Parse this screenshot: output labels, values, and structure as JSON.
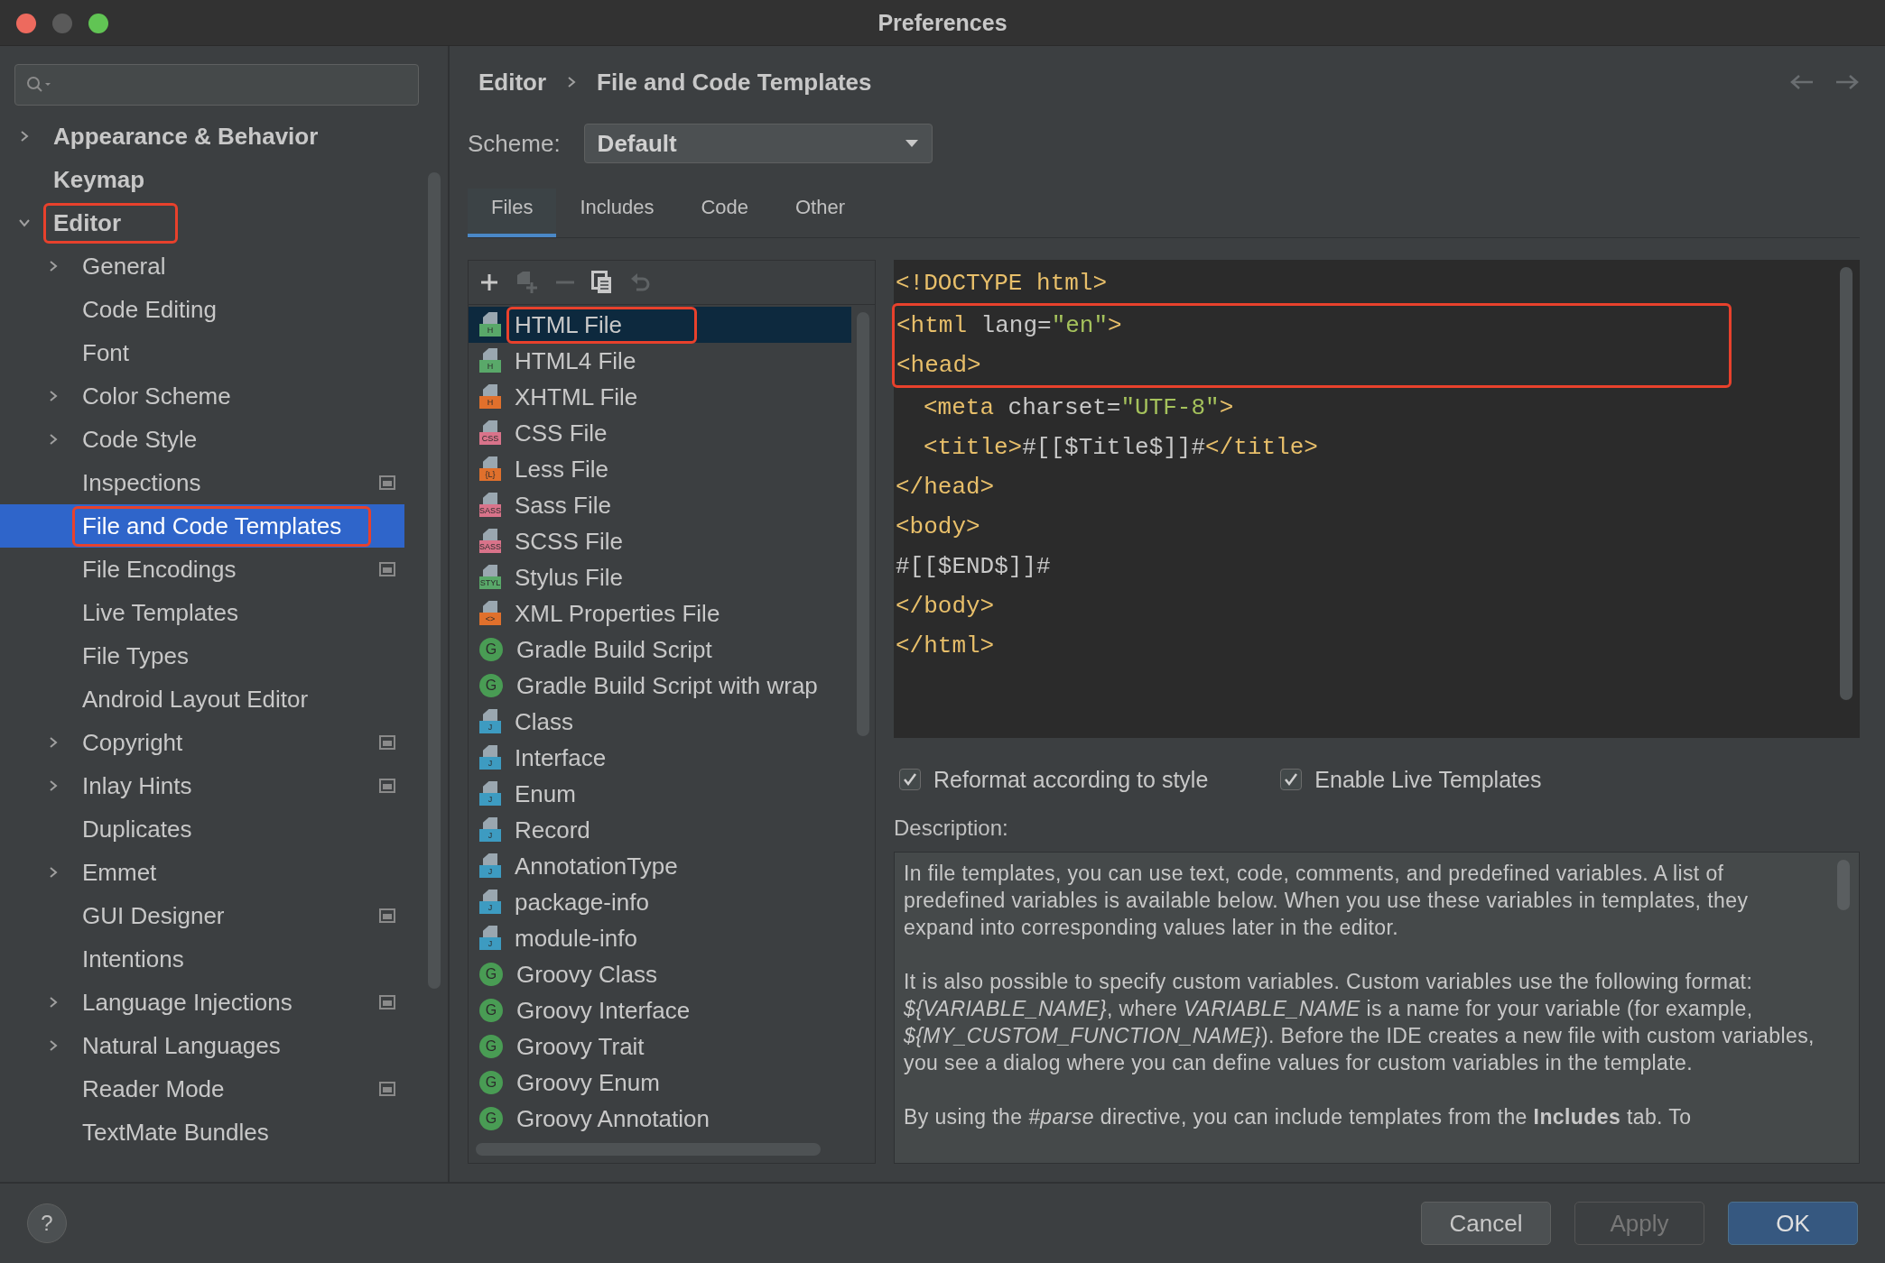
{
  "window": {
    "title": "Preferences"
  },
  "sidebar": {
    "items": [
      {
        "label": "Appearance & Behavior",
        "expanded": false,
        "selected": false,
        "highlighted": false
      },
      {
        "label": "Keymap",
        "selected": false,
        "highlighted": false
      },
      {
        "label": "Editor",
        "expanded": true,
        "selected": false,
        "highlighted": true,
        "children": [
          {
            "label": "General",
            "expanded": false,
            "selected": false,
            "highlighted": false
          },
          {
            "label": "Code Editing",
            "selected": false,
            "highlighted": false
          },
          {
            "label": "Font",
            "selected": false,
            "highlighted": false
          },
          {
            "label": "Color Scheme",
            "expanded": false,
            "selected": false,
            "highlighted": false
          },
          {
            "label": "Code Style",
            "expanded": false,
            "selected": false,
            "highlighted": false
          },
          {
            "label": "Inspections",
            "selected": false,
            "highlighted": false,
            "project_icon": true
          },
          {
            "label": "File and Code Templates",
            "selected": true,
            "highlighted": true
          },
          {
            "label": "File Encodings",
            "selected": false,
            "highlighted": false,
            "project_icon": true
          },
          {
            "label": "Live Templates",
            "selected": false,
            "highlighted": false
          },
          {
            "label": "File Types",
            "selected": false,
            "highlighted": false
          },
          {
            "label": "Android Layout Editor",
            "selected": false,
            "highlighted": false
          },
          {
            "label": "Copyright",
            "expanded": false,
            "selected": false,
            "highlighted": false,
            "project_icon": true
          },
          {
            "label": "Inlay Hints",
            "expanded": false,
            "selected": false,
            "highlighted": false,
            "project_icon": true
          },
          {
            "label": "Duplicates",
            "selected": false,
            "highlighted": false
          },
          {
            "label": "Emmet",
            "expanded": false,
            "selected": false,
            "highlighted": false
          },
          {
            "label": "GUI Designer",
            "selected": false,
            "highlighted": false,
            "project_icon": true
          },
          {
            "label": "Intentions",
            "selected": false,
            "highlighted": false
          },
          {
            "label": "Language Injections",
            "expanded": false,
            "selected": false,
            "highlighted": false,
            "project_icon": true
          },
          {
            "label": "Natural Languages",
            "expanded": false,
            "selected": false,
            "highlighted": false
          },
          {
            "label": "Reader Mode",
            "selected": false,
            "highlighted": false,
            "project_icon": true
          },
          {
            "label": "TextMate Bundles",
            "selected": false,
            "highlighted": false
          }
        ]
      }
    ]
  },
  "breadcrumb": [
    "Editor",
    "File and Code Templates"
  ],
  "scheme": {
    "label": "Scheme:",
    "value": "Default"
  },
  "tabs": [
    {
      "label": "Files",
      "selected": true
    },
    {
      "label": "Includes",
      "selected": false
    },
    {
      "label": "Code",
      "selected": false
    },
    {
      "label": "Other",
      "selected": false
    }
  ],
  "toolbar": [
    {
      "kind": "add",
      "disabled": false
    },
    {
      "kind": "add-copy",
      "disabled": true
    },
    {
      "kind": "remove",
      "disabled": true
    },
    {
      "kind": "copy",
      "disabled": false
    },
    {
      "kind": "reset",
      "disabled": true
    }
  ],
  "templates": [
    {
      "label": "HTML File",
      "selected": true,
      "highlighted": true,
      "icon": {
        "kind": "file",
        "text": "H",
        "color": "#59a869"
      }
    },
    {
      "label": "HTML4 File",
      "selected": false,
      "highlighted": false,
      "icon": {
        "kind": "file",
        "text": "H",
        "color": "#59a869"
      }
    },
    {
      "label": "XHTML File",
      "selected": false,
      "highlighted": false,
      "icon": {
        "kind": "file",
        "text": "H",
        "color": "#e0702c"
      }
    },
    {
      "label": "CSS File",
      "selected": false,
      "highlighted": false,
      "icon": {
        "kind": "file",
        "text": "CSS",
        "color": "#d9738a"
      }
    },
    {
      "label": "Less File",
      "selected": false,
      "highlighted": false,
      "icon": {
        "kind": "file",
        "text": "{L}",
        "color": "#e0702c"
      }
    },
    {
      "label": "Sass File",
      "selected": false,
      "highlighted": false,
      "icon": {
        "kind": "file",
        "text": "SASS",
        "color": "#d9738a"
      }
    },
    {
      "label": "SCSS File",
      "selected": false,
      "highlighted": false,
      "icon": {
        "kind": "file",
        "text": "SASS",
        "color": "#d9738a"
      }
    },
    {
      "label": "Stylus File",
      "selected": false,
      "highlighted": false,
      "icon": {
        "kind": "file",
        "text": "STYL",
        "color": "#59a869"
      }
    },
    {
      "label": "XML Properties File",
      "selected": false,
      "highlighted": false,
      "icon": {
        "kind": "file",
        "text": "<>",
        "color": "#e0702c"
      }
    },
    {
      "label": "Gradle Build Script",
      "selected": false,
      "highlighted": false,
      "icon": {
        "kind": "circle",
        "text": "G",
        "color": "#499c54"
      }
    },
    {
      "label": "Gradle Build Script with wrap",
      "selected": false,
      "highlighted": false,
      "icon": {
        "kind": "circle",
        "text": "G",
        "color": "#499c54"
      }
    },
    {
      "label": "Class",
      "selected": false,
      "highlighted": false,
      "icon": {
        "kind": "file",
        "text": "J",
        "color": "#3d9bc1"
      }
    },
    {
      "label": "Interface",
      "selected": false,
      "highlighted": false,
      "icon": {
        "kind": "file",
        "text": "J",
        "color": "#3d9bc1"
      }
    },
    {
      "label": "Enum",
      "selected": false,
      "highlighted": false,
      "icon": {
        "kind": "file",
        "text": "J",
        "color": "#3d9bc1"
      }
    },
    {
      "label": "Record",
      "selected": false,
      "highlighted": false,
      "icon": {
        "kind": "file",
        "text": "J",
        "color": "#3d9bc1"
      }
    },
    {
      "label": "AnnotationType",
      "selected": false,
      "highlighted": false,
      "icon": {
        "kind": "file",
        "text": "J",
        "color": "#3d9bc1"
      }
    },
    {
      "label": "package-info",
      "selected": false,
      "highlighted": false,
      "icon": {
        "kind": "file",
        "text": "J",
        "color": "#3d9bc1"
      }
    },
    {
      "label": "module-info",
      "selected": false,
      "highlighted": false,
      "icon": {
        "kind": "file",
        "text": "J",
        "color": "#3d9bc1"
      }
    },
    {
      "label": "Groovy Class",
      "selected": false,
      "highlighted": false,
      "icon": {
        "kind": "circle",
        "text": "G",
        "color": "#499c54"
      }
    },
    {
      "label": "Groovy Interface",
      "selected": false,
      "highlighted": false,
      "icon": {
        "kind": "circle",
        "text": "G",
        "color": "#499c54"
      }
    },
    {
      "label": "Groovy Trait",
      "selected": false,
      "highlighted": false,
      "icon": {
        "kind": "circle",
        "text": "G",
        "color": "#499c54"
      }
    },
    {
      "label": "Groovy Enum",
      "selected": false,
      "highlighted": false,
      "icon": {
        "kind": "circle",
        "text": "G",
        "color": "#499c54"
      }
    },
    {
      "label": "Groovy Annotation",
      "selected": false,
      "highlighted": false,
      "icon": {
        "kind": "circle",
        "text": "G",
        "color": "#499c54"
      }
    }
  ],
  "code_lines": [
    {
      "highlighted": false,
      "indented": false,
      "parts": [
        {
          "kind": "tag",
          "text": "<!DOCTYPE html>"
        }
      ]
    },
    {
      "highlighted": true,
      "indented": false,
      "parts": [
        {
          "kind": "tag",
          "text": "<html"
        },
        {
          "kind": "text",
          "text": " lang="
        },
        {
          "kind": "value",
          "text": "\"en\""
        },
        {
          "kind": "tag",
          "text": ">"
        }
      ]
    },
    {
      "highlighted": true,
      "indented": false,
      "parts": [
        {
          "kind": "tag",
          "text": "<head>"
        }
      ]
    },
    {
      "highlighted": false,
      "indented": true,
      "parts": [
        {
          "kind": "tag",
          "text": "<meta"
        },
        {
          "kind": "text",
          "text": " charset="
        },
        {
          "kind": "value",
          "text": "\"UTF-8\""
        },
        {
          "kind": "tag",
          "text": ">"
        }
      ]
    },
    {
      "highlighted": false,
      "indented": true,
      "parts": [
        {
          "kind": "tag",
          "text": "<title>"
        },
        {
          "kind": "text",
          "text": "#[[$Title$]]#"
        },
        {
          "kind": "tag",
          "text": "</title>"
        }
      ]
    },
    {
      "highlighted": false,
      "indented": false,
      "parts": [
        {
          "kind": "tag",
          "text": "</head>"
        }
      ]
    },
    {
      "highlighted": false,
      "indented": false,
      "parts": [
        {
          "kind": "tag",
          "text": "<body>"
        }
      ]
    },
    {
      "highlighted": false,
      "indented": false,
      "parts": [
        {
          "kind": "text",
          "text": "#[[$END$]]#"
        }
      ]
    },
    {
      "highlighted": false,
      "indented": false,
      "parts": [
        {
          "kind": "tag",
          "text": "</body>"
        }
      ]
    },
    {
      "highlighted": false,
      "indented": false,
      "parts": [
        {
          "kind": "tag",
          "text": "</html>"
        }
      ]
    }
  ],
  "options": [
    {
      "label": "Reformat according to style",
      "checked": true
    },
    {
      "label": "Enable Live Templates",
      "checked": true
    }
  ],
  "description": {
    "label": "Description:",
    "paragraphs": [
      "In file templates, you can use text, code, comments, and predefined variables. A list of predefined variables is available below. When you use these variables in templates, they expand into corresponding values later in the editor.",
      "It is also possible to specify custom variables. Custom variables use the following format: *${VARIABLE_NAME}*, where *VARIABLE_NAME* is a name for your variable (for example, *${MY_CUSTOM_FUNCTION_NAME}*). Before the IDE creates a new file with custom variables, you see a dialog where you can define values for custom variables in the template.",
      "By using the *#parse* directive, you can include templates from the **Includes** tab. To"
    ]
  },
  "help": "?",
  "buttons": [
    {
      "label": "Cancel",
      "kind": "normal",
      "disabled": false
    },
    {
      "label": "Apply",
      "kind": "normal",
      "disabled": true
    },
    {
      "label": "OK",
      "kind": "default",
      "disabled": false
    }
  ]
}
